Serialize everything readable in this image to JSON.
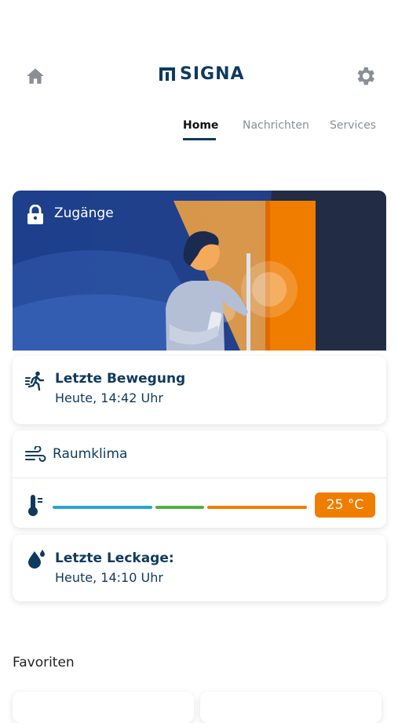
{
  "header": {
    "brand": "SIGNA",
    "icons": {
      "home": "home-icon",
      "settings": "gear-icon"
    }
  },
  "tabs": [
    {
      "label": "Home",
      "active": true
    },
    {
      "label": "Nachrichten",
      "active": false
    },
    {
      "label": "Services",
      "active": false
    }
  ],
  "hero": {
    "title": "Zugänge",
    "icon": "lock-icon"
  },
  "cards": {
    "movement": {
      "title": "Letzte Bewegung",
      "subtitle": "Heute, 14:42 Uhr",
      "icon": "running-person-icon"
    },
    "climate": {
      "title": "Raumklima",
      "temperature": "25 °C",
      "icon": "wind-icon",
      "thermo_icon": "thermometer-icon"
    },
    "leak": {
      "title": "Letzte Leckage:",
      "subtitle": "Heute, 14:10 Uhr",
      "icon": "water-drop-icon"
    }
  },
  "favorites": {
    "title": "Favoriten"
  },
  "colors": {
    "brand": "#0f3a5f",
    "accent": "#f07d00",
    "bar_cold": "#2aa7cb",
    "bar_ok": "#4db33d",
    "bar_warm": "#f07d00"
  }
}
